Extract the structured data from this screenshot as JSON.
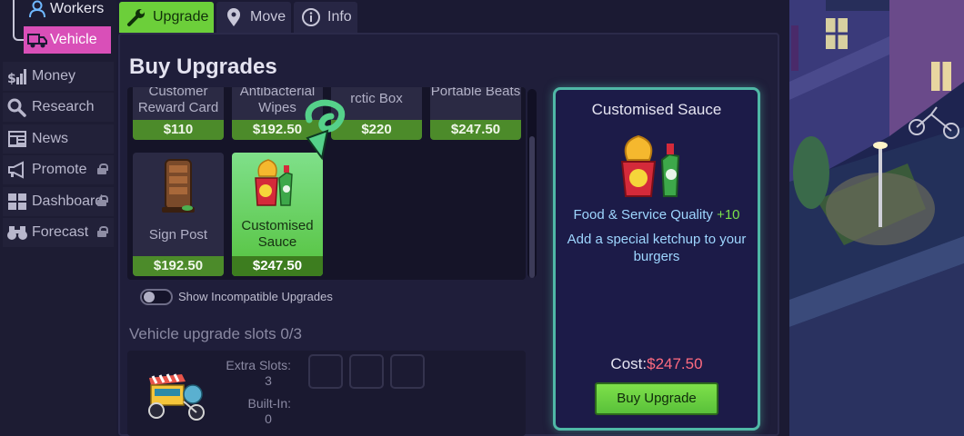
{
  "sidebar": {
    "sub_items": [
      {
        "label": "Workers",
        "icon": "worker-icon"
      },
      {
        "label": "Vehicle",
        "icon": "truck-icon"
      }
    ],
    "items": [
      {
        "label": "Money",
        "icon": "money-chart-icon",
        "locked": false
      },
      {
        "label": "Research",
        "icon": "search-icon",
        "locked": false
      },
      {
        "label": "News",
        "icon": "newspaper-icon",
        "locked": false
      },
      {
        "label": "Promote",
        "icon": "megaphone-icon",
        "locked": true
      },
      {
        "label": "Dashboard",
        "icon": "dashboard-icon",
        "locked": true
      },
      {
        "label": "Forecast",
        "icon": "binoculars-icon",
        "locked": true
      }
    ]
  },
  "tabs": [
    {
      "label": "Upgrade",
      "icon": "wrench-icon",
      "active": true
    },
    {
      "label": "Move",
      "icon": "map-pin-icon",
      "active": false
    },
    {
      "label": "Info",
      "icon": "info-icon",
      "active": false
    }
  ],
  "title": "Buy Upgrades",
  "upgrades": [
    {
      "name": "Customer Reward Card",
      "price": "$110"
    },
    {
      "name": "Antibacterial Wipes",
      "price": "$192.50"
    },
    {
      "name": "rctic Box",
      "price": "$220"
    },
    {
      "name": "Portable Beats",
      "price": "$247.50"
    },
    {
      "name": "Sign Post",
      "price": "$192.50"
    },
    {
      "name": "Customised Sauce",
      "price": "$247.50",
      "selected": true
    }
  ],
  "toggle_label": "Show Incompatible Upgrades",
  "slots": {
    "title": "Vehicle upgrade slots  0/3",
    "extra_label": "Extra Slots:",
    "extra_value": "3",
    "builtin_label": "Built-In:",
    "builtin_value": "0"
  },
  "detail": {
    "name": "Customised Sauce",
    "stat": "Food & Service Quality",
    "stat_bonus": "+10",
    "description": "Add a special ketchup to your burgers",
    "cost_label": "Cost:",
    "cost": "$247.50",
    "buy_label": "Buy Upgrade"
  },
  "colors": {
    "accent_green": "#6ccf3a",
    "nav_active_pink": "#d94fb8",
    "detail_border_teal": "#4fb8a6",
    "cost_red": "#ff6b80"
  }
}
